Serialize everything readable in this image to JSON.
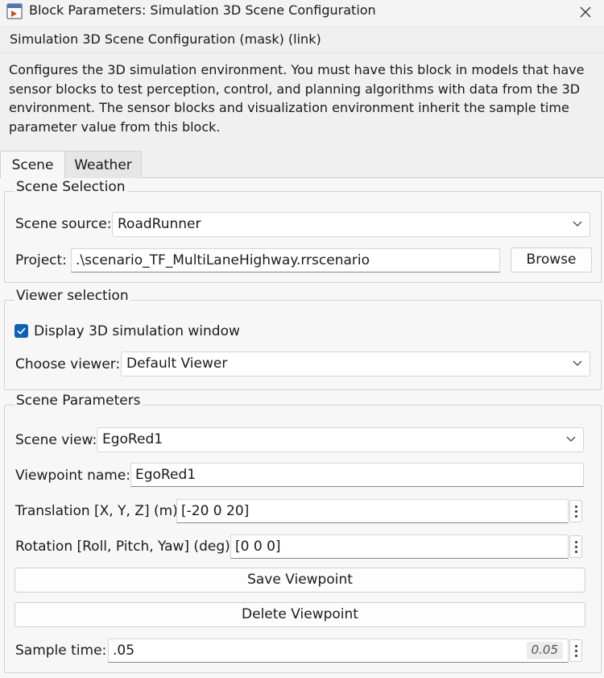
{
  "window": {
    "title": "Block Parameters: Simulation 3D Scene Configuration",
    "app_icon": "simulink-block-icon",
    "close_icon": "close-icon"
  },
  "mask_title": "Simulation 3D Scene Configuration (mask) (link)",
  "description": "Configures the 3D simulation environment. You must have this block in models that have sensor blocks to test perception, control, and planning algorithms with data from the 3D environment. The sensor blocks and visualization environment inherit the sample time parameter value from this block.",
  "tabs": [
    {
      "label": "Scene",
      "active": true
    },
    {
      "label": "Weather",
      "active": false
    }
  ],
  "scene_selection": {
    "title": "Scene Selection",
    "source_label": "Scene source:",
    "source_value": "RoadRunner",
    "project_label": "Project:",
    "project_value": ".\\scenario_TF_MultiLaneHighway.rrscenario",
    "browse_label": "Browse"
  },
  "viewer_selection": {
    "title": "Viewer selection",
    "display_label": "Display 3D simulation window",
    "display_checked": true,
    "choose_label": "Choose viewer:",
    "choose_value": "Default Viewer"
  },
  "scene_parameters": {
    "title": "Scene Parameters",
    "view_label": "Scene view:",
    "view_value": "EgoRed1",
    "viewpoint_label": "Viewpoint name:",
    "viewpoint_value": "EgoRed1",
    "translation_label": "Translation [X, Y, Z] (m):",
    "translation_value": "[-20 0 20]",
    "rotation_label": "Rotation [Roll, Pitch, Yaw] (deg):",
    "rotation_value": "[0 0 0]",
    "save_label": "Save Viewpoint",
    "delete_label": "Delete Viewpoint",
    "sample_label": "Sample time:",
    "sample_value": ".05",
    "sample_evaluated": "0.05"
  },
  "colors": {
    "accent": "#0b62b8",
    "panel": "#f7f7f7",
    "header": "#f0f0f0"
  }
}
